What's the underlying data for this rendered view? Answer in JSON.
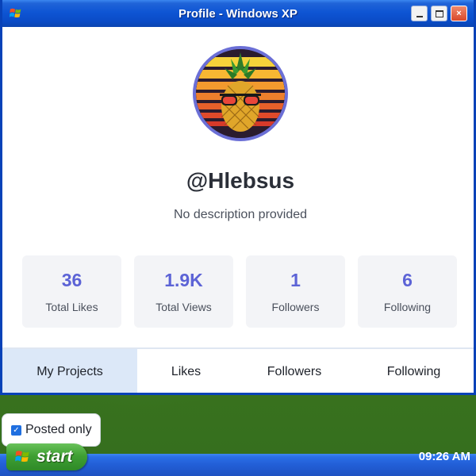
{
  "window": {
    "title": "Profile - Windows XP",
    "buttons": {
      "minimize": "minimize",
      "maximize": "maximize",
      "close": "×"
    }
  },
  "profile": {
    "username": "@Hlebsus",
    "description": "No description provided",
    "avatar_icon": "pineapple-with-sunglasses-avatar"
  },
  "stats": [
    {
      "value": "36",
      "label": "Total Likes"
    },
    {
      "value": "1.9K",
      "label": "Total Views"
    },
    {
      "value": "1",
      "label": "Followers"
    },
    {
      "value": "6",
      "label": "Following"
    }
  ],
  "tabs": [
    {
      "label": "My Projects",
      "active": true
    },
    {
      "label": "Likes",
      "active": false
    },
    {
      "label": "Followers",
      "active": false
    },
    {
      "label": "Following",
      "active": false
    }
  ],
  "filter": {
    "label": "Posted only",
    "checked": true
  },
  "taskbar": {
    "start_label": "start",
    "clock": "09:26 AM"
  },
  "colors": {
    "accent": "#5c63d6",
    "active_tab_bg": "#dce8f8",
    "title_blue": "#0a4bc6"
  }
}
